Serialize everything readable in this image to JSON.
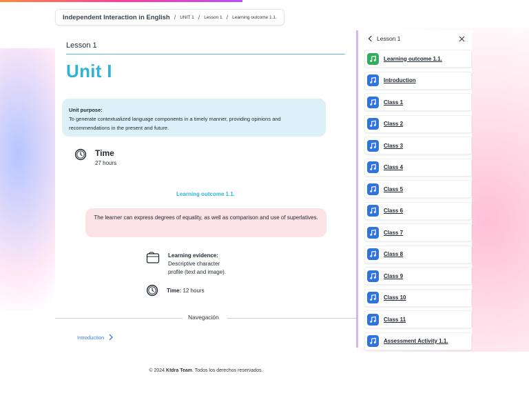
{
  "breadcrumb": {
    "course": "Independent Interaction in English",
    "unit": "UNIT 1",
    "lesson": "Lesson 1",
    "outcome": "Learning outcome 1.1."
  },
  "main": {
    "lesson_label": "Lesson 1",
    "unit_title": "Unit I",
    "purpose_label": "Unit purpose:",
    "purpose_text": "To generate contextualized language components in a timely manner, providing opinions and recommendations in the present and future.",
    "time_title": "Time",
    "time_value": "27 hours",
    "outcome_title": "Learning outcome 1.1.",
    "outcome_text": "The learner can express degrees of equality, as well as comparison and use of superlatives.",
    "evidence_label": "Learning evidence:",
    "evidence_text_1": "Descriptive character",
    "evidence_text_2": "profile (text and image).",
    "time2_label": "Time:",
    "time2_value": "12 hours",
    "nav_label": "Navegación",
    "next_label": "Introduction"
  },
  "sidebar": {
    "title": "Lesson 1",
    "items": [
      {
        "label": "Learning outcome 1.1.",
        "badge": "green"
      },
      {
        "label": "Introduction",
        "badge": "blue"
      },
      {
        "label": "Class 1",
        "badge": "blue"
      },
      {
        "label": "Class 2",
        "badge": "blue"
      },
      {
        "label": "Class 3",
        "badge": "blue"
      },
      {
        "label": "Class 4",
        "badge": "blue"
      },
      {
        "label": "Class 5",
        "badge": "blue"
      },
      {
        "label": "Class 6",
        "badge": "blue"
      },
      {
        "label": "Class 7",
        "badge": "blue"
      },
      {
        "label": "Class 8",
        "badge": "blue"
      },
      {
        "label": "Class 9",
        "badge": "blue"
      },
      {
        "label": "Class 10",
        "badge": "blue"
      },
      {
        "label": "Class 11",
        "badge": "blue"
      },
      {
        "label": "Assessment Activity 1.1.",
        "badge": "blue"
      }
    ]
  },
  "footer": {
    "prefix": "© 2024",
    "brand": "Ktdra Team",
    "suffix": ". Todos los derechos reservados."
  },
  "colors": {
    "accent": "#2fb3d6",
    "badge_blue": "#2f73e0",
    "badge_green": "#2fae5e"
  }
}
